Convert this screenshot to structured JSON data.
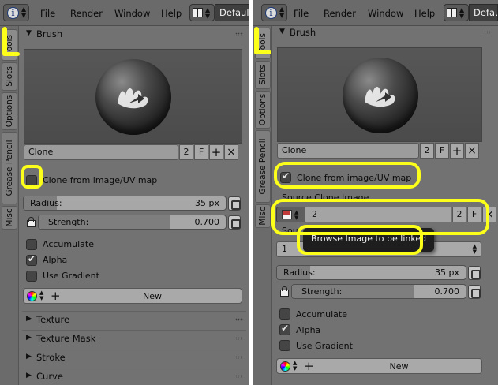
{
  "menubar": {
    "items": [
      "File",
      "Render",
      "Window",
      "Help"
    ],
    "layout_name": "Default"
  },
  "left": {
    "tabs": [
      "Tools",
      "Slots",
      "Options",
      "Grease Pencil",
      "Misc"
    ],
    "brush_panel_title": "Brush",
    "brush_name": "Clone",
    "users": "2",
    "fake_user": "F",
    "add": "+",
    "remove": "×",
    "clone_checkbox_label": "Clone from image/UV map",
    "radius_label": "Radius:",
    "radius_value": "35 px",
    "strength_label": "Strength:",
    "strength_value": "0.700",
    "accumulate_label": "Accumulate",
    "alpha_label": "Alpha",
    "use_gradient_label": "Use Gradient",
    "new_label": "New",
    "collapsed_panels": [
      "Texture",
      "Texture Mask",
      "Stroke",
      "Curve"
    ]
  },
  "right": {
    "tabs": [
      "Tools",
      "Slots",
      "Options",
      "Grease Pencil",
      "Misc"
    ],
    "brush_panel_title": "Brush",
    "brush_name": "Clone",
    "users": "2",
    "fake_user": "F",
    "add": "+",
    "remove": "×",
    "clone_checkbox_label": "Clone from image/UV map",
    "source_clone_image_label": "Source Clone Image",
    "image_name": "2",
    "image_users": "2",
    "image_fake": "F",
    "source_uv_label": "Sou",
    "uv_value": "1",
    "tooltip": "Browse Image to be linked",
    "radius_label": "Radius:",
    "radius_value": "35 px",
    "strength_label": "Strength:",
    "strength_value": "0.700",
    "accumulate_label": "Accumulate",
    "alpha_label": "Alpha",
    "use_gradient_label": "Use Gradient",
    "new_label": "New"
  },
  "colors": {
    "highlight": "#fcff1a",
    "panel_bg": "#727272"
  }
}
